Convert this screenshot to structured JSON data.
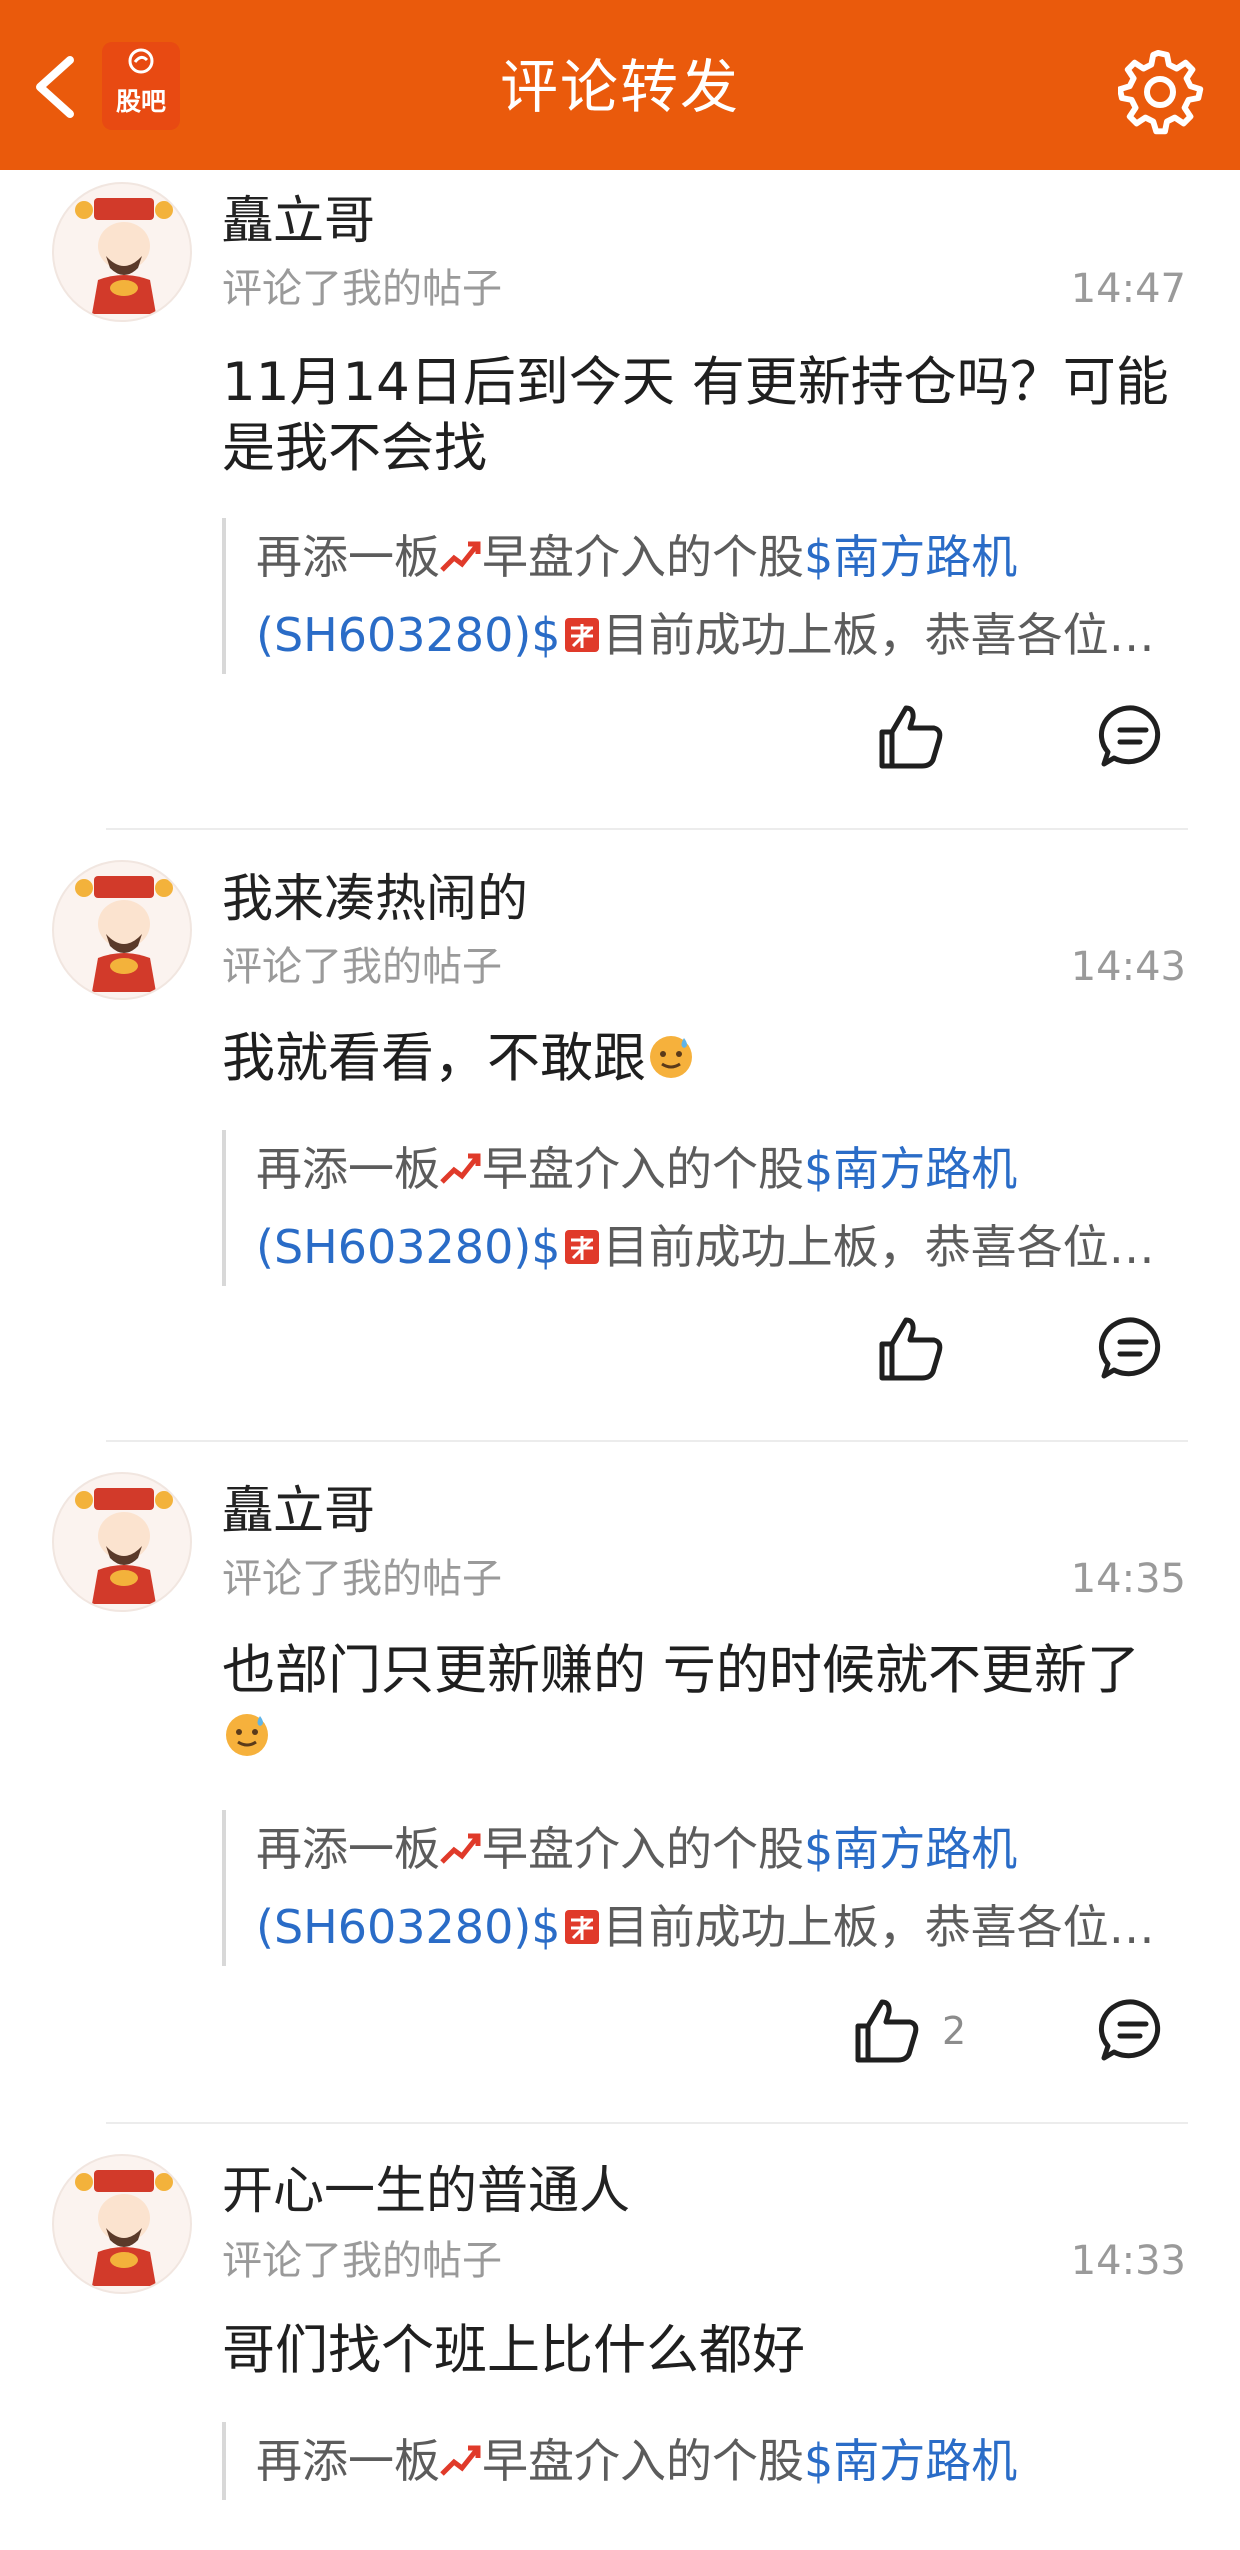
{
  "header": {
    "title": "评论转发",
    "logo_text": "股吧",
    "back_icon": "chevron-left-icon",
    "settings_icon": "gear-icon"
  },
  "colors": {
    "header_bg": "#ea5a0c",
    "link": "#2a6cc7",
    "meta_text": "#9a9a9a"
  },
  "comments": [
    {
      "username": "矗立哥",
      "subtitle": "评论了我的帖子",
      "time": "14:47",
      "content": "11月14日后到今天 有更新持仓吗？可能是我不会找",
      "quote_prefix": "再添一板",
      "quote_middle": "早盘介入的个股",
      "quote_link": "$南方路机(SH603280)$",
      "quote_link_line1": "$南方路机",
      "quote_link_line2": "(SH603280)$",
      "quote_suffix": "目前成功上板，恭喜各位…",
      "likes": ""
    },
    {
      "username": "我来凑热闹的",
      "subtitle": "评论了我的帖子",
      "time": "14:43",
      "content": "我就看看，不敢跟",
      "quote_prefix": "再添一板",
      "quote_middle": "早盘介入的个股",
      "quote_link_line1": "$南方路机",
      "quote_link_line2": "(SH603280)$",
      "quote_suffix": "目前成功上板，恭喜各位…",
      "likes": ""
    },
    {
      "username": "矗立哥",
      "subtitle": "评论了我的帖子",
      "time": "14:35",
      "content": "也部门只更新赚的  亏的时候就不更新了",
      "quote_prefix": "再添一板",
      "quote_middle": "早盘介入的个股",
      "quote_link_line1": "$南方路机",
      "quote_link_line2": "(SH603280)$",
      "quote_suffix": "目前成功上板，恭喜各位…",
      "likes": "2"
    },
    {
      "username": "开心一生的普通人",
      "subtitle": "评论了我的帖子",
      "time": "14:33",
      "content": "哥们找个班上比什么都好",
      "quote_prefix": "再添一板",
      "quote_middle": "早盘介入的个股",
      "quote_link_line1": "$南方路机",
      "quote_link_line2": "",
      "quote_suffix": "",
      "likes": ""
    }
  ]
}
